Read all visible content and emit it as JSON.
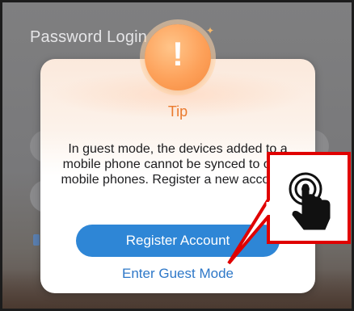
{
  "background": {
    "title": "Password Login"
  },
  "dialog": {
    "icon": "warning-exclamation-icon",
    "title": "Tip",
    "message": "In guest mode, the devices added to a mobile phone cannot be synced to other mobile phones. Register a new account?",
    "primary_button": "Register Account",
    "secondary_link": "Enter Guest Mode"
  },
  "callout": {
    "icon": "tap-gesture-icon",
    "border_color": "#e00000"
  },
  "colors": {
    "accent_blue": "#2e86d6",
    "title_orange": "#ea7a2d",
    "link_blue": "#2e78c8"
  }
}
